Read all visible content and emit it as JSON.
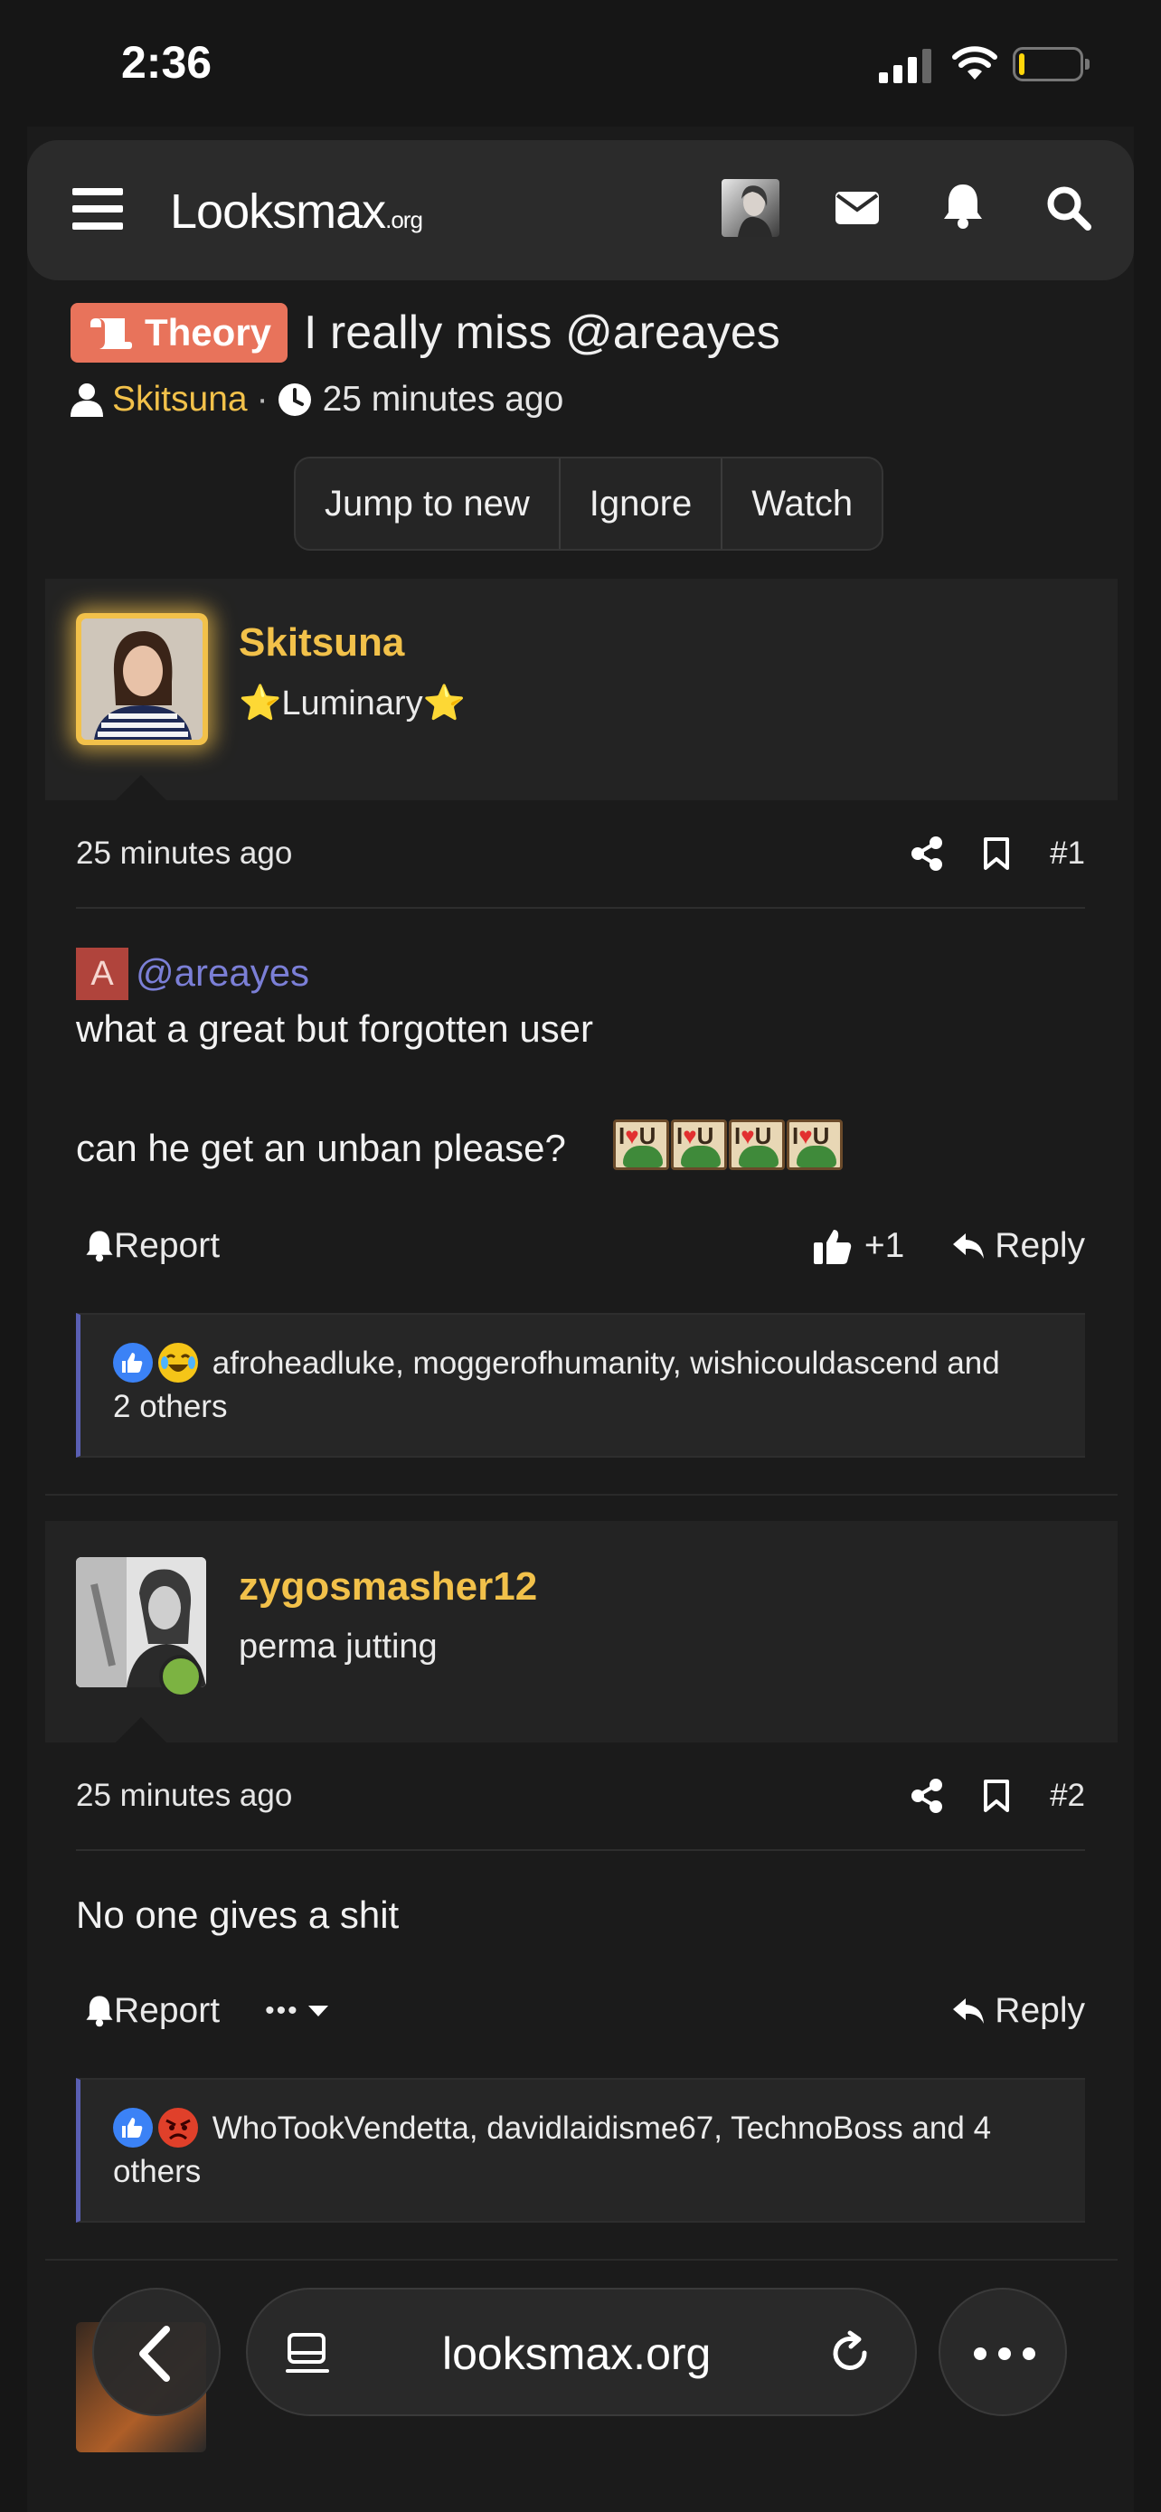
{
  "status_bar": {
    "time": "2:36"
  },
  "header": {
    "logo_text": "Looksmax",
    "logo_tld": ".org"
  },
  "thread": {
    "prefix": "Theory",
    "title": "I really miss @areayes",
    "author": "Skitsuna",
    "separator": "·",
    "time": "25 minutes ago",
    "actions": [
      "Jump to new",
      "Ignore",
      "Watch"
    ]
  },
  "posts": [
    {
      "username": "Skitsuna",
      "user_title": "⭐Luminary⭐",
      "time": "25 minutes ago",
      "number": "#1",
      "mention_avatar_letter": "A",
      "mention": "@areayes",
      "lines": [
        "what a great but forgotten user",
        "can he get an unban please?"
      ],
      "emoji_text": "I♥U",
      "report_label": "Report",
      "like_count": "+1",
      "reply_label": "Reply",
      "reactions_line1": "afroheadluke, moggerofhumanity, wishicouldascend and",
      "reactions_line2": "2 others"
    },
    {
      "username": "zygosmasher12",
      "user_title": "perma jutting",
      "time": "25 minutes ago",
      "number": "#2",
      "lines": [
        "No one gives a shit"
      ],
      "report_label": "Report",
      "more_label": "•••",
      "reply_label": "Reply",
      "reactions_line1": "WhoTookVendetta, davidlaidisme67, TechnoBoss and 4",
      "reactions_line2": "others"
    }
  ],
  "browser": {
    "url": "looksmax.org"
  },
  "colors": {
    "background": "#161616",
    "accent_username": "#f2c14a",
    "prefix_badge": "#e8735b",
    "mention": "#7b7fd6",
    "reaction_border": "#5a5fb3"
  }
}
